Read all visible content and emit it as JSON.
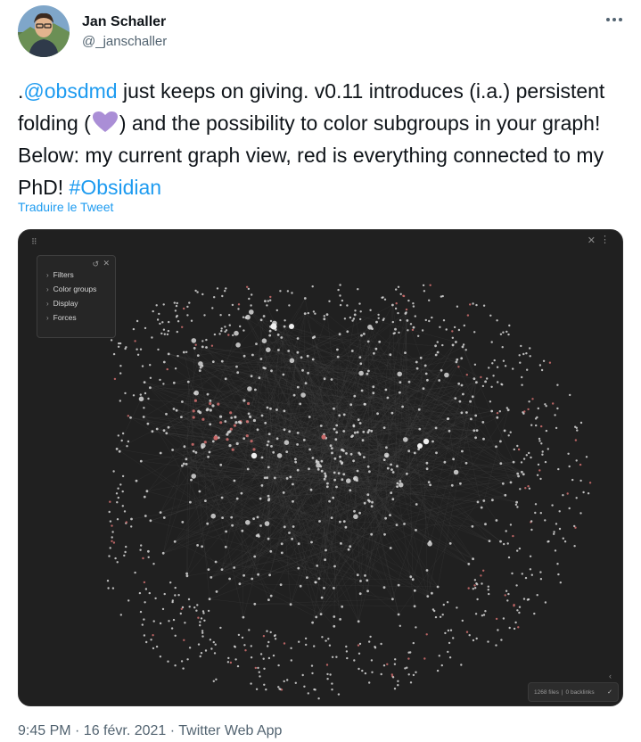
{
  "author": {
    "name": "Jan Schaller",
    "handle": "@_janschaller",
    "avatar_icon": "avatar-photo"
  },
  "tweet": {
    "prefix": ".",
    "mention": "@obsdmd",
    "part1": " just keeps on giving. v0.11 introduces (i.a.) persistent folding (",
    "emoji_icon": "purple-heart-icon",
    "part2": ") and the possibility to color subgroups in your graph! Below: my current graph view, red is everything connected to my PhD! ",
    "hashtag": "#Obsidian",
    "translate_label": "Traduire le Tweet"
  },
  "graph_view": {
    "panel": {
      "items": [
        "Filters",
        "Color groups",
        "Display",
        "Forces"
      ]
    },
    "status": {
      "files": "1268 files",
      "backlinks": "0 backlinks"
    },
    "colors": {
      "background": "#202020",
      "node": "#d9d9d9",
      "highlight": "#c96a6a",
      "edge": "#4a4a4a"
    }
  },
  "footer": {
    "timestamp": "9:45 PM · 16 févr. 2021 · Twitter Web App"
  }
}
